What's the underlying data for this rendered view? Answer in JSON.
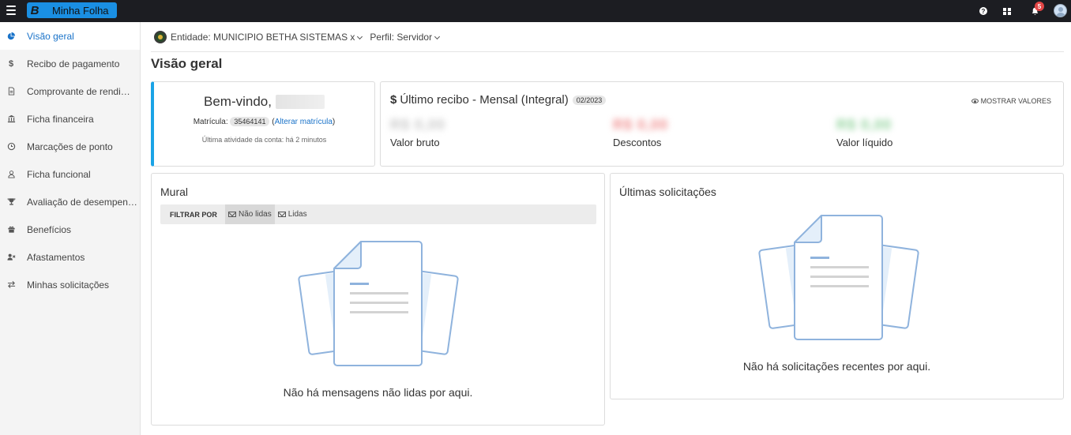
{
  "app": {
    "logo_letter": "B",
    "name": "Minha Folha",
    "notifications_count": "5"
  },
  "sidebar": {
    "items": [
      {
        "label": "Visão geral",
        "icon": "pie-chart-icon",
        "active": true
      },
      {
        "label": "Recibo de pagamento",
        "icon": "dollar-icon"
      },
      {
        "label": "Comprovante de rendimentos",
        "icon": "document-icon"
      },
      {
        "label": "Ficha financeira",
        "icon": "bank-icon"
      },
      {
        "label": "Marcações de ponto",
        "icon": "clock-icon"
      },
      {
        "label": "Ficha funcional",
        "icon": "user-icon"
      },
      {
        "label": "Avaliação de desempenho",
        "icon": "trophy-icon"
      },
      {
        "label": "Benefícios",
        "icon": "gift-icon"
      },
      {
        "label": "Afastamentos",
        "icon": "user-x-icon"
      },
      {
        "label": "Minhas solicitações",
        "icon": "exchange-icon"
      }
    ]
  },
  "context": {
    "entity": "Entidade: MUNICIPIO BETHA SISTEMAS x",
    "profile": "Perfil: Servidor"
  },
  "page": {
    "title": "Visão geral"
  },
  "welcome": {
    "greeting": "Bem-vindo,",
    "matricula_label": "Matrícula:",
    "matricula_value": "35464141",
    "alterar_label": "Alterar matrícula",
    "last_activity": "Última atividade da conta: há 2 minutos"
  },
  "recibo": {
    "title": "Último recibo - Mensal (Integral)",
    "period": "02/2023",
    "show_values_label": "MOSTRAR VALORES",
    "bruto_value": "R$ 0,00",
    "bruto_label": "Valor bruto",
    "descontos_value": "R$ 0,00",
    "descontos_label": "Descontos",
    "liquido_value": "R$ 0,00",
    "liquido_label": "Valor líquido"
  },
  "mural": {
    "title": "Mural",
    "filter_label": "FILTRAR POR",
    "tab_unread": "Não lidas",
    "tab_read": "Lidas",
    "empty_message": "Não há mensagens não lidas por aqui."
  },
  "solicitacoes": {
    "title": "Últimas solicitações",
    "empty_message": "Não há solicitações recentes por aqui."
  },
  "colors": {
    "accent": "#1a73c9",
    "brand": "#1a8fe3",
    "topbar": "#1c1d22",
    "welcome_border": "#1aa3e6"
  }
}
